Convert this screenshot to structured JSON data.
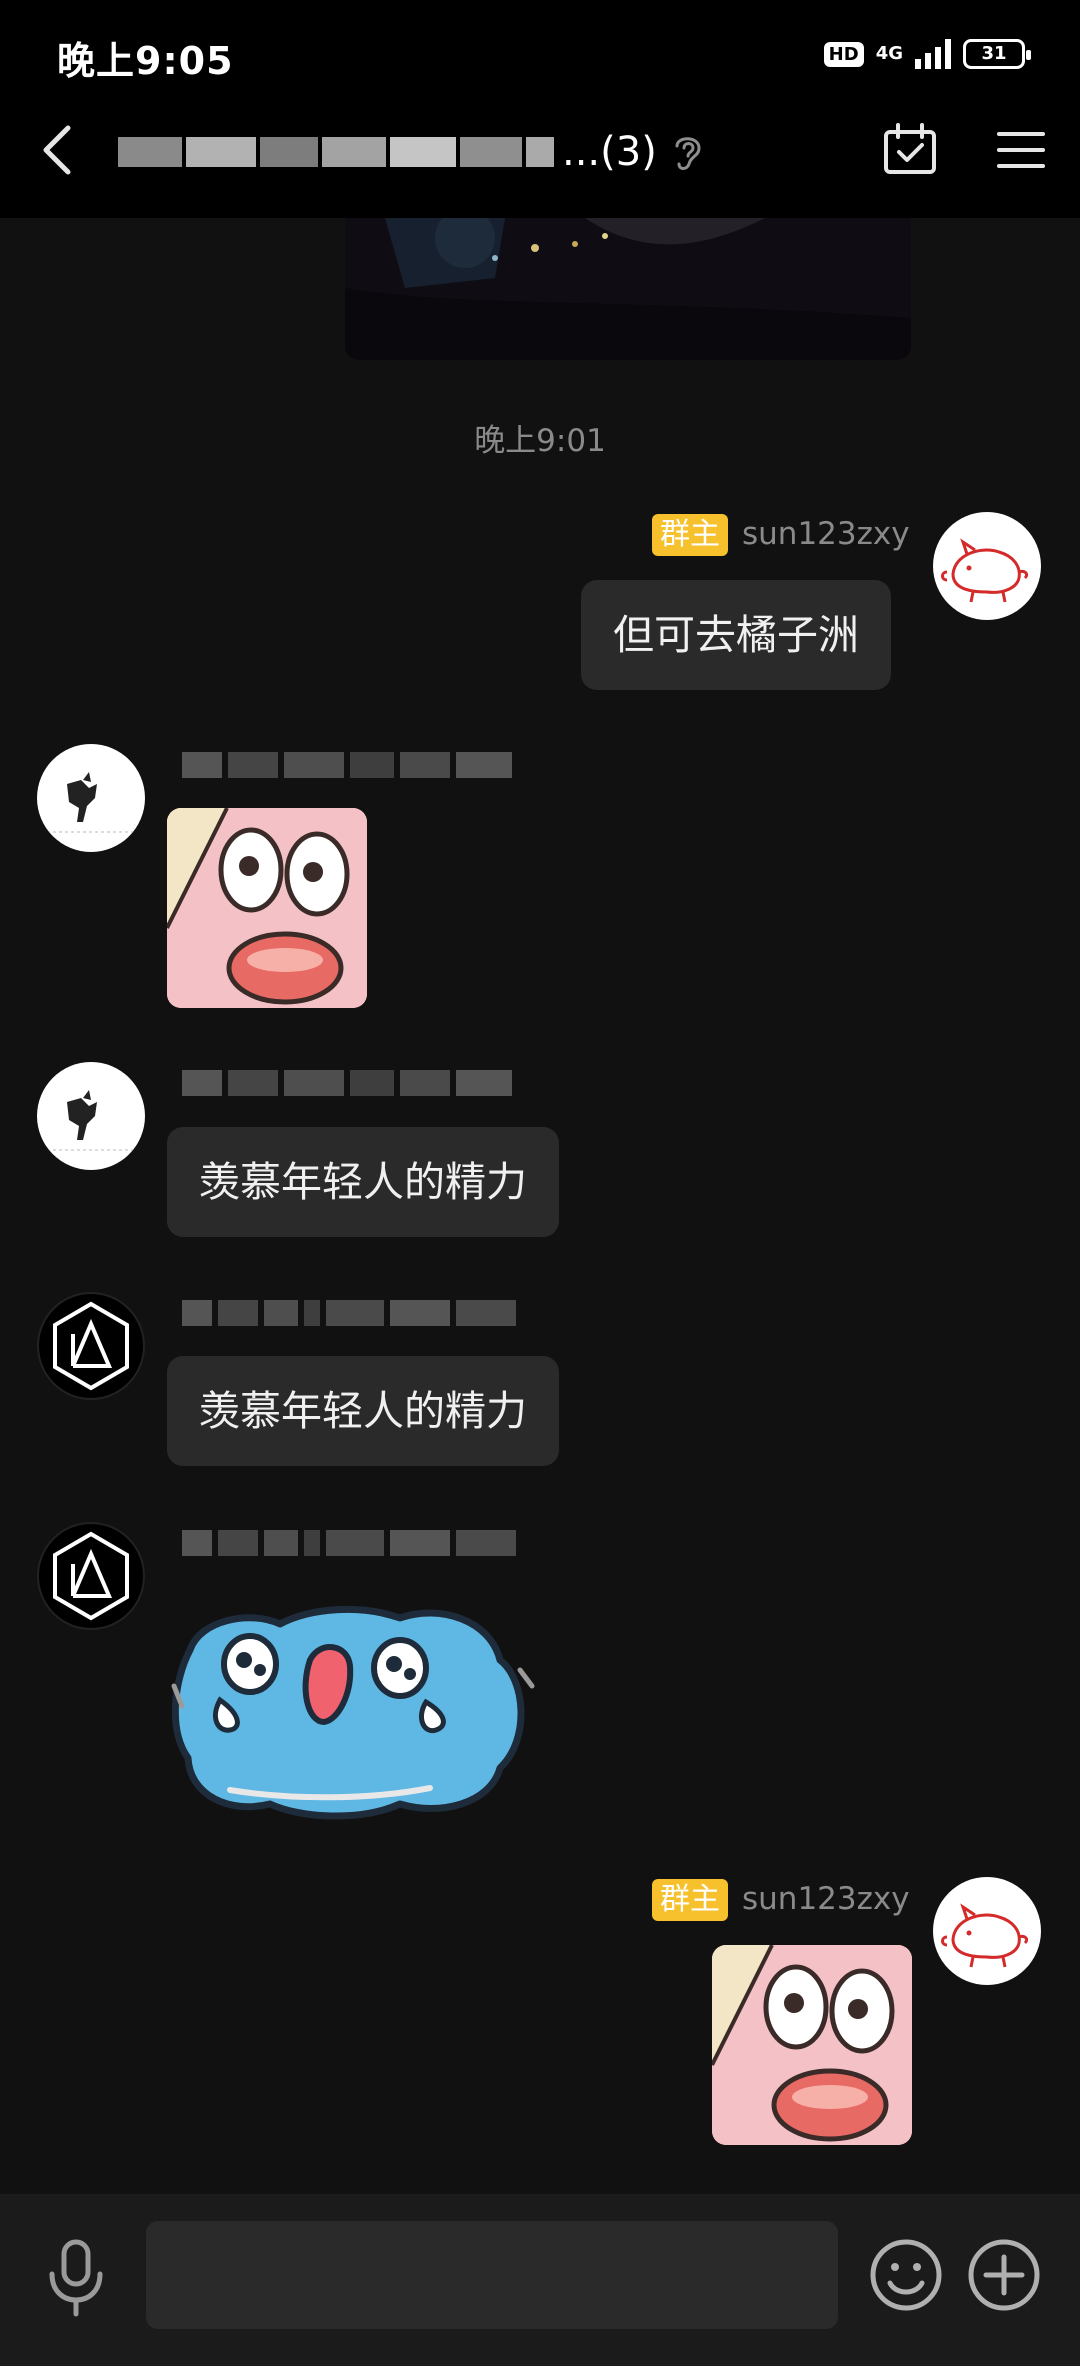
{
  "status_bar": {
    "time": "晚上9:05",
    "hd_label": "HD",
    "network": "4G",
    "battery": "31"
  },
  "header": {
    "title_suffix": "...(3)",
    "icons": [
      "back-icon",
      "ear-icon",
      "calendar-check-icon",
      "menu-icon"
    ]
  },
  "timestamp": "晚上9:01",
  "messages": [
    {
      "side": "right",
      "badge": "群主",
      "user": "sun123zxy",
      "text": "但可去橘子洲"
    },
    {
      "side": "left",
      "type": "sticker",
      "sticker": "patrick-shocked"
    },
    {
      "side": "left",
      "text": "羡慕年轻人的精力"
    },
    {
      "side": "left",
      "text": "羡慕年轻人的精力"
    },
    {
      "side": "left",
      "type": "sticker",
      "sticker": "blue-blob-crying"
    },
    {
      "side": "right",
      "badge": "群主",
      "user": "sun123zxy",
      "type": "sticker",
      "sticker": "patrick-shocked"
    }
  ],
  "input": {
    "placeholder": ""
  },
  "colors": {
    "background": "#111111",
    "bubble": "#2a2a2a",
    "badge": "#f6c12c",
    "bar": "#000000"
  }
}
